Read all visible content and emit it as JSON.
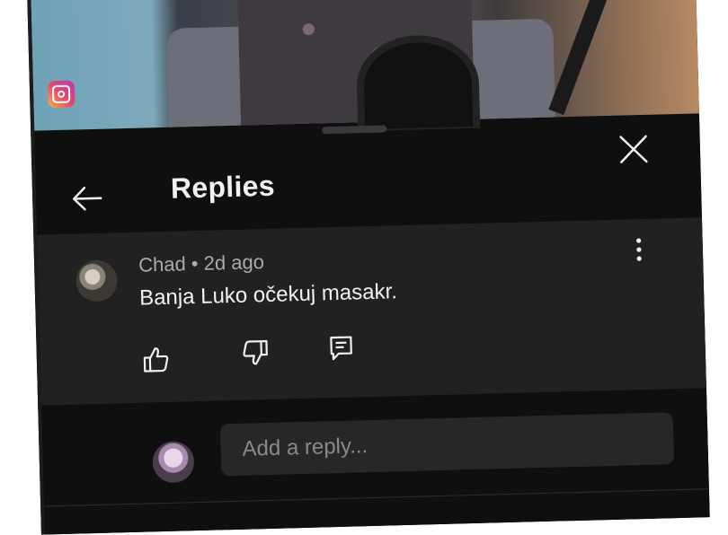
{
  "video": {
    "overlay_icon": "instagram-icon"
  },
  "sheet": {
    "title": "Replies",
    "back_icon": "arrow-left-icon",
    "close_icon": "close-icon"
  },
  "comment": {
    "author": "Chad",
    "separator": " • ",
    "time": "2d ago",
    "text": "Banja Luko očekuj masakr.",
    "menu_icon": "kebab-icon",
    "actions": [
      {
        "icon": "thumb-up-icon"
      },
      {
        "icon": "thumb-down-icon"
      },
      {
        "icon": "reply-icon"
      }
    ]
  },
  "composer": {
    "placeholder": "Add a reply..."
  },
  "colors": {
    "background": "#0f0f0f",
    "comment_bg": "#212121",
    "text_primary": "#f1f1f1",
    "text_secondary": "#aaaaaa"
  }
}
